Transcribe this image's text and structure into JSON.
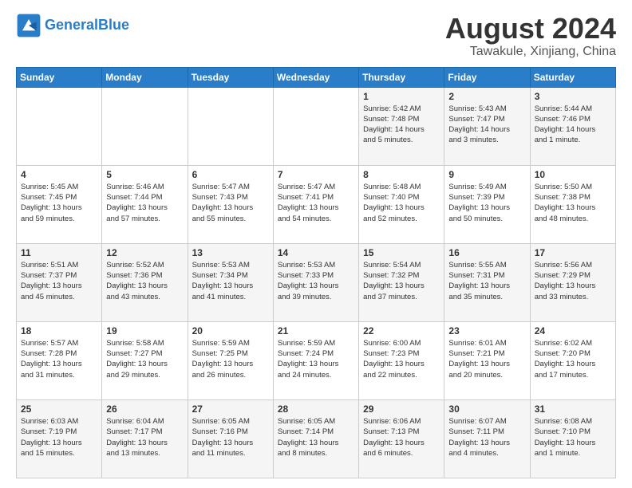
{
  "header": {
    "logo_general": "General",
    "logo_blue": "Blue",
    "main_title": "August 2024",
    "sub_title": "Tawakule, Xinjiang, China"
  },
  "calendar": {
    "days_of_week": [
      "Sunday",
      "Monday",
      "Tuesday",
      "Wednesday",
      "Thursday",
      "Friday",
      "Saturday"
    ],
    "weeks": [
      [
        {
          "num": "",
          "info": ""
        },
        {
          "num": "",
          "info": ""
        },
        {
          "num": "",
          "info": ""
        },
        {
          "num": "",
          "info": ""
        },
        {
          "num": "1",
          "info": "Sunrise: 5:42 AM\nSunset: 7:48 PM\nDaylight: 14 hours\nand 5 minutes."
        },
        {
          "num": "2",
          "info": "Sunrise: 5:43 AM\nSunset: 7:47 PM\nDaylight: 14 hours\nand 3 minutes."
        },
        {
          "num": "3",
          "info": "Sunrise: 5:44 AM\nSunset: 7:46 PM\nDaylight: 14 hours\nand 1 minute."
        }
      ],
      [
        {
          "num": "4",
          "info": "Sunrise: 5:45 AM\nSunset: 7:45 PM\nDaylight: 13 hours\nand 59 minutes."
        },
        {
          "num": "5",
          "info": "Sunrise: 5:46 AM\nSunset: 7:44 PM\nDaylight: 13 hours\nand 57 minutes."
        },
        {
          "num": "6",
          "info": "Sunrise: 5:47 AM\nSunset: 7:43 PM\nDaylight: 13 hours\nand 55 minutes."
        },
        {
          "num": "7",
          "info": "Sunrise: 5:47 AM\nSunset: 7:41 PM\nDaylight: 13 hours\nand 54 minutes."
        },
        {
          "num": "8",
          "info": "Sunrise: 5:48 AM\nSunset: 7:40 PM\nDaylight: 13 hours\nand 52 minutes."
        },
        {
          "num": "9",
          "info": "Sunrise: 5:49 AM\nSunset: 7:39 PM\nDaylight: 13 hours\nand 50 minutes."
        },
        {
          "num": "10",
          "info": "Sunrise: 5:50 AM\nSunset: 7:38 PM\nDaylight: 13 hours\nand 48 minutes."
        }
      ],
      [
        {
          "num": "11",
          "info": "Sunrise: 5:51 AM\nSunset: 7:37 PM\nDaylight: 13 hours\nand 45 minutes."
        },
        {
          "num": "12",
          "info": "Sunrise: 5:52 AM\nSunset: 7:36 PM\nDaylight: 13 hours\nand 43 minutes."
        },
        {
          "num": "13",
          "info": "Sunrise: 5:53 AM\nSunset: 7:34 PM\nDaylight: 13 hours\nand 41 minutes."
        },
        {
          "num": "14",
          "info": "Sunrise: 5:53 AM\nSunset: 7:33 PM\nDaylight: 13 hours\nand 39 minutes."
        },
        {
          "num": "15",
          "info": "Sunrise: 5:54 AM\nSunset: 7:32 PM\nDaylight: 13 hours\nand 37 minutes."
        },
        {
          "num": "16",
          "info": "Sunrise: 5:55 AM\nSunset: 7:31 PM\nDaylight: 13 hours\nand 35 minutes."
        },
        {
          "num": "17",
          "info": "Sunrise: 5:56 AM\nSunset: 7:29 PM\nDaylight: 13 hours\nand 33 minutes."
        }
      ],
      [
        {
          "num": "18",
          "info": "Sunrise: 5:57 AM\nSunset: 7:28 PM\nDaylight: 13 hours\nand 31 minutes."
        },
        {
          "num": "19",
          "info": "Sunrise: 5:58 AM\nSunset: 7:27 PM\nDaylight: 13 hours\nand 29 minutes."
        },
        {
          "num": "20",
          "info": "Sunrise: 5:59 AM\nSunset: 7:25 PM\nDaylight: 13 hours\nand 26 minutes."
        },
        {
          "num": "21",
          "info": "Sunrise: 5:59 AM\nSunset: 7:24 PM\nDaylight: 13 hours\nand 24 minutes."
        },
        {
          "num": "22",
          "info": "Sunrise: 6:00 AM\nSunset: 7:23 PM\nDaylight: 13 hours\nand 22 minutes."
        },
        {
          "num": "23",
          "info": "Sunrise: 6:01 AM\nSunset: 7:21 PM\nDaylight: 13 hours\nand 20 minutes."
        },
        {
          "num": "24",
          "info": "Sunrise: 6:02 AM\nSunset: 7:20 PM\nDaylight: 13 hours\nand 17 minutes."
        }
      ],
      [
        {
          "num": "25",
          "info": "Sunrise: 6:03 AM\nSunset: 7:19 PM\nDaylight: 13 hours\nand 15 minutes."
        },
        {
          "num": "26",
          "info": "Sunrise: 6:04 AM\nSunset: 7:17 PM\nDaylight: 13 hours\nand 13 minutes."
        },
        {
          "num": "27",
          "info": "Sunrise: 6:05 AM\nSunset: 7:16 PM\nDaylight: 13 hours\nand 11 minutes."
        },
        {
          "num": "28",
          "info": "Sunrise: 6:05 AM\nSunset: 7:14 PM\nDaylight: 13 hours\nand 8 minutes."
        },
        {
          "num": "29",
          "info": "Sunrise: 6:06 AM\nSunset: 7:13 PM\nDaylight: 13 hours\nand 6 minutes."
        },
        {
          "num": "30",
          "info": "Sunrise: 6:07 AM\nSunset: 7:11 PM\nDaylight: 13 hours\nand 4 minutes."
        },
        {
          "num": "31",
          "info": "Sunrise: 6:08 AM\nSunset: 7:10 PM\nDaylight: 13 hours\nand 1 minute."
        }
      ]
    ]
  }
}
